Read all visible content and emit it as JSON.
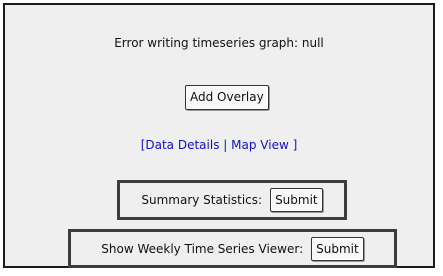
{
  "error_message": "Error writing timeseries graph: null",
  "overlay": {
    "button_label": "Add Overlay"
  },
  "links": {
    "open_bracket": "[",
    "data_details": "Data Details",
    "separator": "|",
    "map_view": "Map View",
    "close_bracket": "]"
  },
  "summary_statistics": {
    "label": "Summary Statistics:",
    "submit_label": "Submit"
  },
  "weekly_viewer": {
    "label": "Show Weekly Time Series Viewer:",
    "submit_label": "Submit"
  },
  "colors": {
    "panel_background": "#efefef",
    "link": "#1010c8",
    "border": "#3c3c3c"
  }
}
